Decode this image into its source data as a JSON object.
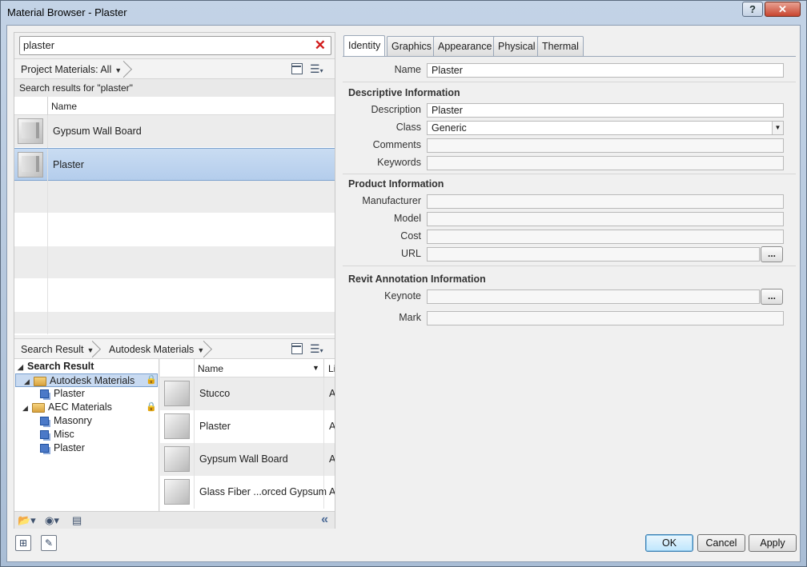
{
  "window": {
    "title": "Material Browser - Plaster",
    "help_label": "?",
    "close_label": "✕"
  },
  "search": {
    "value": "plaster",
    "clear_label": "✕"
  },
  "project_bar": {
    "filter_label": "Project Materials: All"
  },
  "results_label": "Search results for \"plaster\"",
  "project_grid": {
    "column": "Name",
    "rows": [
      {
        "name": "Gypsum Wall Board",
        "selected": false
      },
      {
        "name": "Plaster",
        "selected": true
      }
    ]
  },
  "library_bar": {
    "crumb1": "Search Result",
    "crumb2": "Autodesk Materials"
  },
  "tree": {
    "header": "Search Result",
    "nodes": [
      {
        "label": "Autodesk Materials",
        "type": "folder",
        "locked": true
      },
      {
        "label": "Plaster",
        "type": "material"
      },
      {
        "label": "AEC Materials",
        "type": "folder",
        "locked": true
      },
      {
        "label": "Masonry",
        "type": "material"
      },
      {
        "label": "Misc",
        "type": "material"
      },
      {
        "label": "Plaster",
        "type": "material"
      }
    ]
  },
  "library_grid": {
    "columns": [
      "Name",
      "Li"
    ],
    "rows": [
      {
        "name": "Stucco",
        "col2": "A"
      },
      {
        "name": "Plaster",
        "col2": "A"
      },
      {
        "name": "Gypsum Wall Board",
        "col2": "A"
      },
      {
        "name": "Glass Fiber ...orced Gypsum",
        "col2": "A"
      }
    ]
  },
  "tabs": [
    "Identity",
    "Graphics",
    "Appearance",
    "Physical",
    "Thermal"
  ],
  "active_tab": "Identity",
  "identity": {
    "name_label": "Name",
    "name_value": "Plaster",
    "descriptive": {
      "title": "Descriptive Information",
      "description_label": "Description",
      "description_value": "Plaster",
      "class_label": "Class",
      "class_value": "Generic",
      "comments_label": "Comments",
      "comments_value": "",
      "keywords_label": "Keywords",
      "keywords_value": ""
    },
    "product": {
      "title": "Product Information",
      "manufacturer_label": "Manufacturer",
      "model_label": "Model",
      "cost_label": "Cost",
      "url_label": "URL",
      "browse_label": "..."
    },
    "annotation": {
      "title": "Revit Annotation Information",
      "keynote_label": "Keynote",
      "mark_label": "Mark",
      "browse_label": "..."
    }
  },
  "footer": {
    "ok_label": "OK",
    "cancel_label": "Cancel",
    "apply_label": "Apply"
  },
  "colors": {
    "selection": "#b4cdec",
    "close": "#c8452f",
    "accent": "#3c7fb1"
  }
}
